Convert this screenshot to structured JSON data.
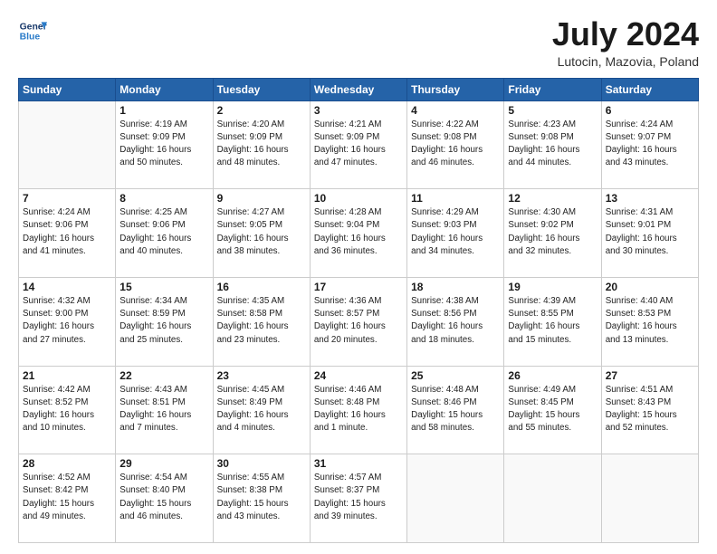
{
  "logo": {
    "line1": "General",
    "line2": "Blue"
  },
  "title": "July 2024",
  "location": "Lutocin, Mazovia, Poland",
  "days_header": [
    "Sunday",
    "Monday",
    "Tuesday",
    "Wednesday",
    "Thursday",
    "Friday",
    "Saturday"
  ],
  "weeks": [
    [
      {
        "num": "",
        "info": ""
      },
      {
        "num": "1",
        "info": "Sunrise: 4:19 AM\nSunset: 9:09 PM\nDaylight: 16 hours\nand 50 minutes."
      },
      {
        "num": "2",
        "info": "Sunrise: 4:20 AM\nSunset: 9:09 PM\nDaylight: 16 hours\nand 48 minutes."
      },
      {
        "num": "3",
        "info": "Sunrise: 4:21 AM\nSunset: 9:09 PM\nDaylight: 16 hours\nand 47 minutes."
      },
      {
        "num": "4",
        "info": "Sunrise: 4:22 AM\nSunset: 9:08 PM\nDaylight: 16 hours\nand 46 minutes."
      },
      {
        "num": "5",
        "info": "Sunrise: 4:23 AM\nSunset: 9:08 PM\nDaylight: 16 hours\nand 44 minutes."
      },
      {
        "num": "6",
        "info": "Sunrise: 4:24 AM\nSunset: 9:07 PM\nDaylight: 16 hours\nand 43 minutes."
      }
    ],
    [
      {
        "num": "7",
        "info": "Sunrise: 4:24 AM\nSunset: 9:06 PM\nDaylight: 16 hours\nand 41 minutes."
      },
      {
        "num": "8",
        "info": "Sunrise: 4:25 AM\nSunset: 9:06 PM\nDaylight: 16 hours\nand 40 minutes."
      },
      {
        "num": "9",
        "info": "Sunrise: 4:27 AM\nSunset: 9:05 PM\nDaylight: 16 hours\nand 38 minutes."
      },
      {
        "num": "10",
        "info": "Sunrise: 4:28 AM\nSunset: 9:04 PM\nDaylight: 16 hours\nand 36 minutes."
      },
      {
        "num": "11",
        "info": "Sunrise: 4:29 AM\nSunset: 9:03 PM\nDaylight: 16 hours\nand 34 minutes."
      },
      {
        "num": "12",
        "info": "Sunrise: 4:30 AM\nSunset: 9:02 PM\nDaylight: 16 hours\nand 32 minutes."
      },
      {
        "num": "13",
        "info": "Sunrise: 4:31 AM\nSunset: 9:01 PM\nDaylight: 16 hours\nand 30 minutes."
      }
    ],
    [
      {
        "num": "14",
        "info": "Sunrise: 4:32 AM\nSunset: 9:00 PM\nDaylight: 16 hours\nand 27 minutes."
      },
      {
        "num": "15",
        "info": "Sunrise: 4:34 AM\nSunset: 8:59 PM\nDaylight: 16 hours\nand 25 minutes."
      },
      {
        "num": "16",
        "info": "Sunrise: 4:35 AM\nSunset: 8:58 PM\nDaylight: 16 hours\nand 23 minutes."
      },
      {
        "num": "17",
        "info": "Sunrise: 4:36 AM\nSunset: 8:57 PM\nDaylight: 16 hours\nand 20 minutes."
      },
      {
        "num": "18",
        "info": "Sunrise: 4:38 AM\nSunset: 8:56 PM\nDaylight: 16 hours\nand 18 minutes."
      },
      {
        "num": "19",
        "info": "Sunrise: 4:39 AM\nSunset: 8:55 PM\nDaylight: 16 hours\nand 15 minutes."
      },
      {
        "num": "20",
        "info": "Sunrise: 4:40 AM\nSunset: 8:53 PM\nDaylight: 16 hours\nand 13 minutes."
      }
    ],
    [
      {
        "num": "21",
        "info": "Sunrise: 4:42 AM\nSunset: 8:52 PM\nDaylight: 16 hours\nand 10 minutes."
      },
      {
        "num": "22",
        "info": "Sunrise: 4:43 AM\nSunset: 8:51 PM\nDaylight: 16 hours\nand 7 minutes."
      },
      {
        "num": "23",
        "info": "Sunrise: 4:45 AM\nSunset: 8:49 PM\nDaylight: 16 hours\nand 4 minutes."
      },
      {
        "num": "24",
        "info": "Sunrise: 4:46 AM\nSunset: 8:48 PM\nDaylight: 16 hours\nand 1 minute."
      },
      {
        "num": "25",
        "info": "Sunrise: 4:48 AM\nSunset: 8:46 PM\nDaylight: 15 hours\nand 58 minutes."
      },
      {
        "num": "26",
        "info": "Sunrise: 4:49 AM\nSunset: 8:45 PM\nDaylight: 15 hours\nand 55 minutes."
      },
      {
        "num": "27",
        "info": "Sunrise: 4:51 AM\nSunset: 8:43 PM\nDaylight: 15 hours\nand 52 minutes."
      }
    ],
    [
      {
        "num": "28",
        "info": "Sunrise: 4:52 AM\nSunset: 8:42 PM\nDaylight: 15 hours\nand 49 minutes."
      },
      {
        "num": "29",
        "info": "Sunrise: 4:54 AM\nSunset: 8:40 PM\nDaylight: 15 hours\nand 46 minutes."
      },
      {
        "num": "30",
        "info": "Sunrise: 4:55 AM\nSunset: 8:38 PM\nDaylight: 15 hours\nand 43 minutes."
      },
      {
        "num": "31",
        "info": "Sunrise: 4:57 AM\nSunset: 8:37 PM\nDaylight: 15 hours\nand 39 minutes."
      },
      {
        "num": "",
        "info": ""
      },
      {
        "num": "",
        "info": ""
      },
      {
        "num": "",
        "info": ""
      }
    ]
  ]
}
